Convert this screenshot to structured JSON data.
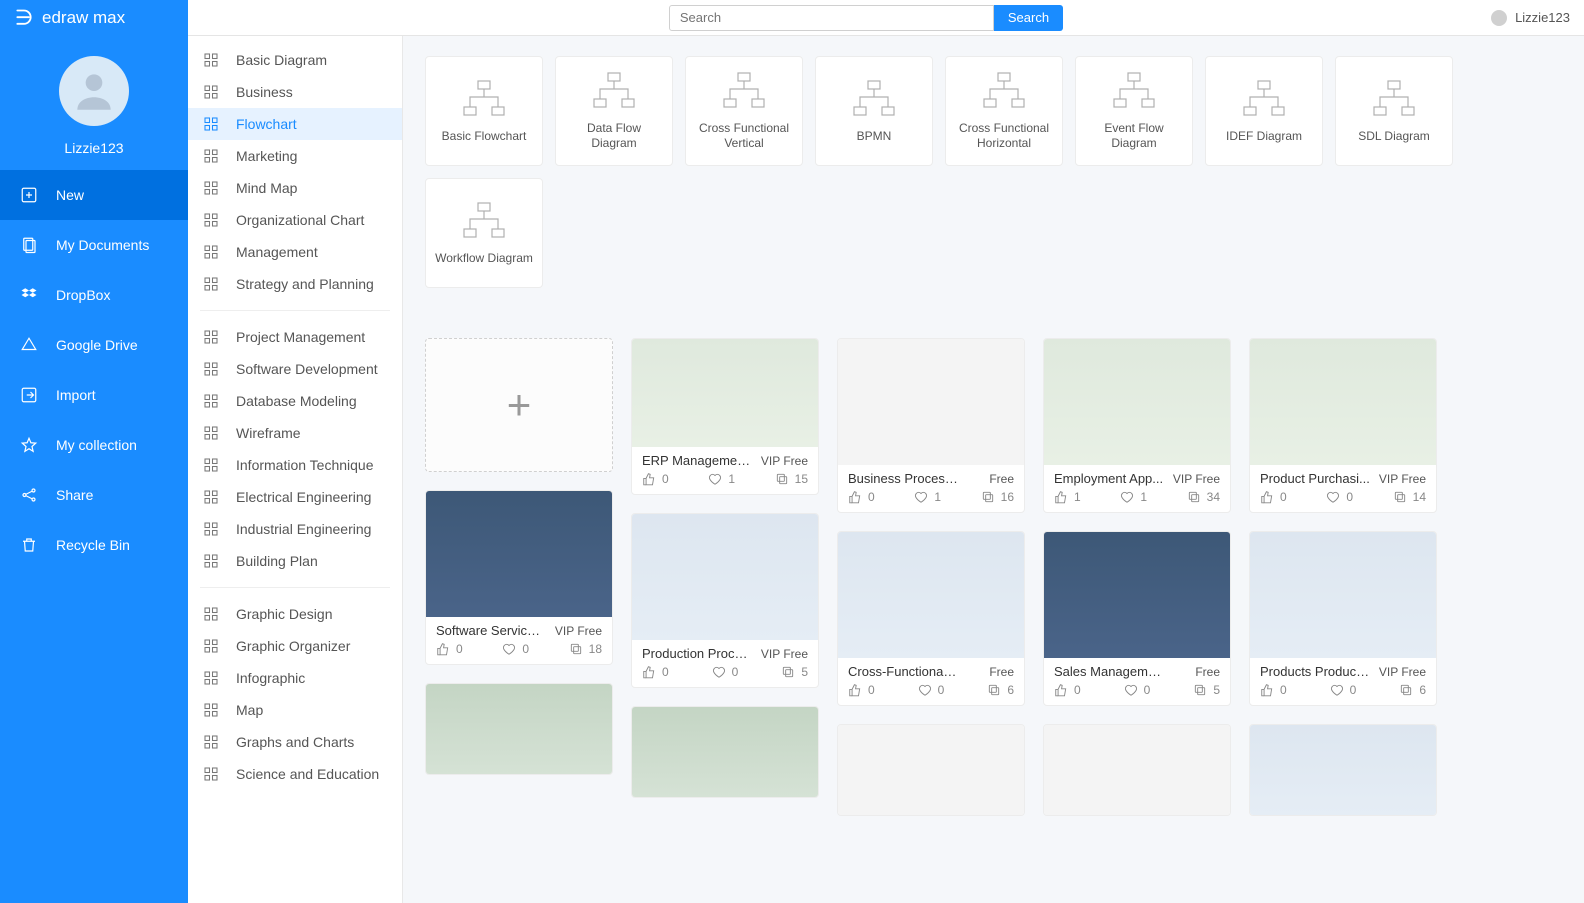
{
  "brand": "edraw max",
  "search": {
    "placeholder": "Search",
    "button": "Search"
  },
  "topUser": "Lizzie123",
  "profile": {
    "name": "Lizzie123"
  },
  "navBlue": [
    {
      "label": "New",
      "active": true,
      "icon": "plus-box"
    },
    {
      "label": "My Documents",
      "active": false,
      "icon": "documents"
    },
    {
      "label": "DropBox",
      "active": false,
      "icon": "dropbox"
    },
    {
      "label": "Google Drive",
      "active": false,
      "icon": "gdrive"
    },
    {
      "label": "Import",
      "active": false,
      "icon": "import"
    },
    {
      "label": "My collection",
      "active": false,
      "icon": "star"
    },
    {
      "label": "Share",
      "active": false,
      "icon": "share"
    },
    {
      "label": "Recycle Bin",
      "active": false,
      "icon": "trash"
    }
  ],
  "categoriesGroups": [
    [
      "Basic Diagram",
      "Business",
      "Flowchart",
      "Marketing",
      "Mind Map",
      "Organizational Chart",
      "Management",
      "Strategy and Planning"
    ],
    [
      "Project Management",
      "Software Development",
      "Database Modeling",
      "Wireframe",
      "Information Technique",
      "Electrical Engineering",
      "Industrial Engineering",
      "Building Plan"
    ],
    [
      "Graphic Design",
      "Graphic Organizer",
      "Infographic",
      "Map",
      "Graphs and Charts",
      "Science and Education"
    ]
  ],
  "activeCategory": "Flowchart",
  "subcategories": [
    "Basic Flowchart",
    "Data Flow Diagram",
    "Cross Functional Vertical",
    "BPMN",
    "Cross Functional Horizontal",
    "Event Flow Diagram",
    "IDEF Diagram",
    "SDL Diagram",
    "Workflow Diagram"
  ],
  "templatesCols": [
    [
      {
        "blank": true
      },
      {
        "title": "Software Service ...",
        "free": "VIP Free",
        "like": 0,
        "fav": 0,
        "copy": 18,
        "thumb": "th-n",
        "h": "h126"
      },
      {
        "partial": true,
        "thumb": "th-gr"
      }
    ],
    [
      {
        "title": "ERP Managemen...",
        "free": "VIP Free",
        "like": 0,
        "fav": 1,
        "copy": 15,
        "thumb": "th-g",
        "h": "h108"
      },
      {
        "title": "Production Proce...",
        "free": "VIP Free",
        "like": 0,
        "fav": 0,
        "copy": 5,
        "thumb": "th-b",
        "h": "h126"
      },
      {
        "partial": true,
        "thumb": "th-gr"
      }
    ],
    [
      {
        "title": "Business Process Mo...",
        "free": "Free",
        "like": 0,
        "fav": 1,
        "copy": 16,
        "thumb": "th-w",
        "h": "h126"
      },
      {
        "title": "Cross-Functional Flo...",
        "free": "Free",
        "like": 0,
        "fav": 0,
        "copy": 6,
        "thumb": "th-b",
        "h": "h126"
      },
      {
        "partial": true,
        "thumb": "th-w"
      }
    ],
    [
      {
        "title": "Employment App...",
        "free": "VIP Free",
        "like": 1,
        "fav": 1,
        "copy": 34,
        "thumb": "th-g",
        "h": "h126"
      },
      {
        "title": "Sales Management C...",
        "free": "Free",
        "like": 0,
        "fav": 0,
        "copy": 5,
        "thumb": "th-n",
        "h": "h126"
      },
      {
        "partial": true,
        "thumb": "th-w"
      }
    ],
    [
      {
        "title": "Product Purchasi...",
        "free": "VIP Free",
        "like": 0,
        "fav": 0,
        "copy": 14,
        "thumb": "th-g",
        "h": "h126"
      },
      {
        "title": "Products Product...",
        "free": "VIP Free",
        "like": 0,
        "fav": 0,
        "copy": 6,
        "thumb": "th-b",
        "h": "h126"
      },
      {
        "partial": true,
        "thumb": "th-b"
      }
    ]
  ]
}
